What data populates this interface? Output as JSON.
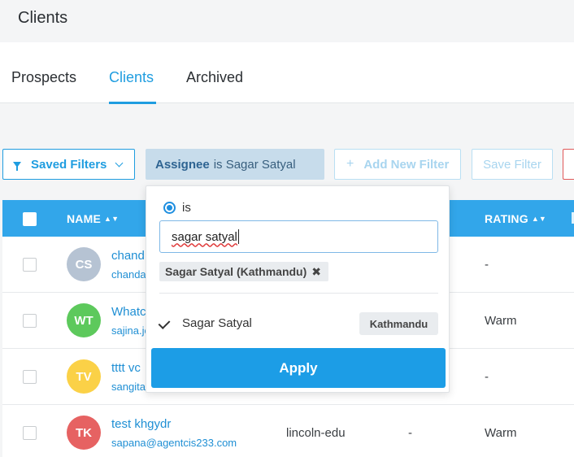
{
  "page": {
    "title": "Clients"
  },
  "tabs": [
    {
      "label": "Prospects"
    },
    {
      "label": "Clients"
    },
    {
      "label": "Archived"
    }
  ],
  "filters": {
    "saved_filters_label": "Saved Filters",
    "assignee_key": "Assignee",
    "assignee_value": "is Sagar Satyal",
    "add_filter_label": "Add New Filter",
    "save_filter_label": "Save Filter"
  },
  "table": {
    "headers": {
      "name": "NAME",
      "rating": "RATING"
    },
    "rows": [
      {
        "initials": "CS",
        "avatar_color": "#b6c3d3",
        "name": "chand",
        "email": "chanda",
        "rating": "-"
      },
      {
        "initials": "WT",
        "avatar_color": "#5dc95c",
        "name": "Whatc",
        "email": "sajina.jc",
        "rating": "Warm"
      },
      {
        "initials": "TV",
        "avatar_color": "#fbd147",
        "name": "tttt vc",
        "email": "sangita",
        "rating": "-"
      },
      {
        "initials": "TK",
        "avatar_color": "#e66262",
        "name": "test khgydr",
        "email": "sapana@agentcis233.com",
        "company": "lincoln-edu",
        "dash": "-",
        "rating": "Warm"
      }
    ]
  },
  "dropdown": {
    "operator_label": "is",
    "search_value": "sagar satyal",
    "selected_chip": "Sagar Satyal (Kathmandu)",
    "chip_remove": "✖",
    "option_label": "Sagar Satyal",
    "option_badge": "Kathmandu",
    "apply_label": "Apply"
  },
  "colors": {
    "accent": "#1f9de0",
    "header_bg": "#32a6ea",
    "assignee_bg": "#c7dceb"
  }
}
